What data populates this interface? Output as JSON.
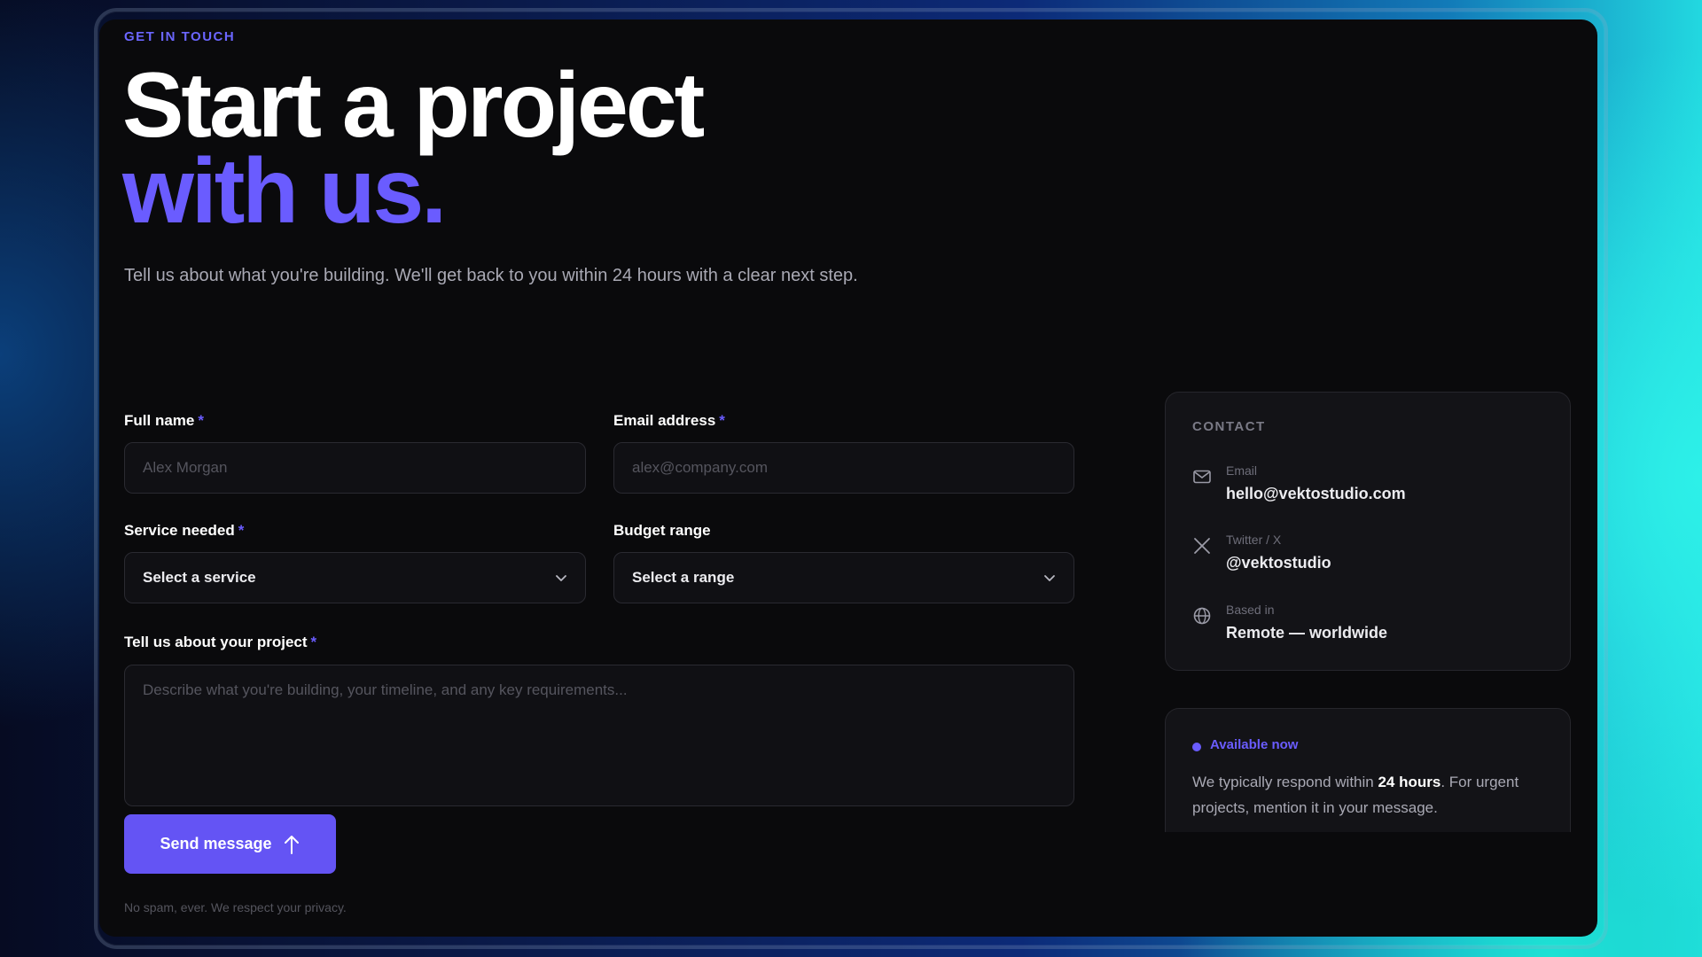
{
  "header": {
    "eyebrow": "GET IN TOUCH",
    "title_line1": "Start a project",
    "title_line2": "with us.",
    "lead": "Tell us about what you're building. We'll get back to you within 24 hours with a clear next step."
  },
  "form": {
    "full_name": {
      "label": "Full name",
      "required_mark": "*",
      "placeholder": "Alex Morgan"
    },
    "email": {
      "label": "Email address",
      "required_mark": "*",
      "placeholder": "alex@company.com"
    },
    "service": {
      "label": "Service needed",
      "required_mark": "*",
      "value": "Select a service"
    },
    "budget": {
      "label": "Budget range",
      "value": "Select a range"
    },
    "project": {
      "label": "Tell us about your project",
      "required_mark": "*",
      "placeholder": "Describe what you're building, your timeline, and any key requirements..."
    },
    "submit_label": "Send message",
    "privacy_note": "No spam, ever. We respect your privacy."
  },
  "contact": {
    "title": "CONTACT",
    "items": [
      {
        "icon": "mail-icon",
        "label": "Email",
        "value": "hello@vektostudio.com"
      },
      {
        "icon": "x-twitter-icon",
        "label": "Twitter / X",
        "value": "@vektostudio"
      },
      {
        "icon": "globe-icon",
        "label": "Based in",
        "value": "Remote — worldwide"
      }
    ]
  },
  "availability": {
    "status": "Available now",
    "text_before": "We typically respond within ",
    "text_bold": "24 hours",
    "text_after": ". For urgent projects, mention it in your message."
  },
  "colors": {
    "accent": "#6a5cff",
    "button": "#6454f4",
    "card_background": "#0a0a0c"
  }
}
